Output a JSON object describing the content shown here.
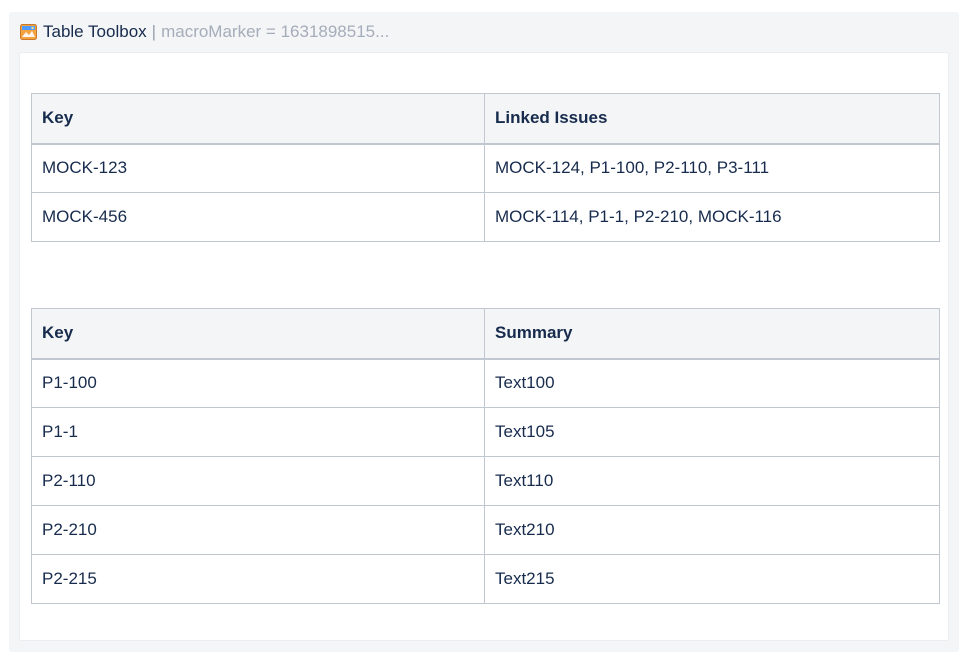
{
  "macro": {
    "title": "Table Toolbox",
    "separator": "|",
    "parameter": "macroMarker = 1631898515..."
  },
  "linked_table": {
    "headers": [
      "Key",
      "Linked Issues"
    ],
    "rows": [
      [
        "MOCK-123",
        "MOCK-124, P1-100, P2-110, P3-111"
      ],
      [
        "MOCK-456",
        "MOCK-114, P1-1, P2-210, MOCK-116"
      ]
    ]
  },
  "summary_table": {
    "headers": [
      "Key",
      "Summary"
    ],
    "rows": [
      [
        "P1-100",
        "Text100"
      ],
      [
        "P1-1",
        "Text105"
      ],
      [
        "P2-110",
        "Text110"
      ],
      [
        "P2-210",
        "Text210"
      ],
      [
        "P2-215",
        "Text215"
      ]
    ]
  },
  "icons": {
    "macro_icon": "table-toolbox-icon"
  },
  "colors": {
    "frame_bg": "#f4f5f7",
    "header_cell_bg": "#f4f5f7",
    "border": "#c1c7d0",
    "text": "#172b4d",
    "param_text": "#a5adba"
  }
}
